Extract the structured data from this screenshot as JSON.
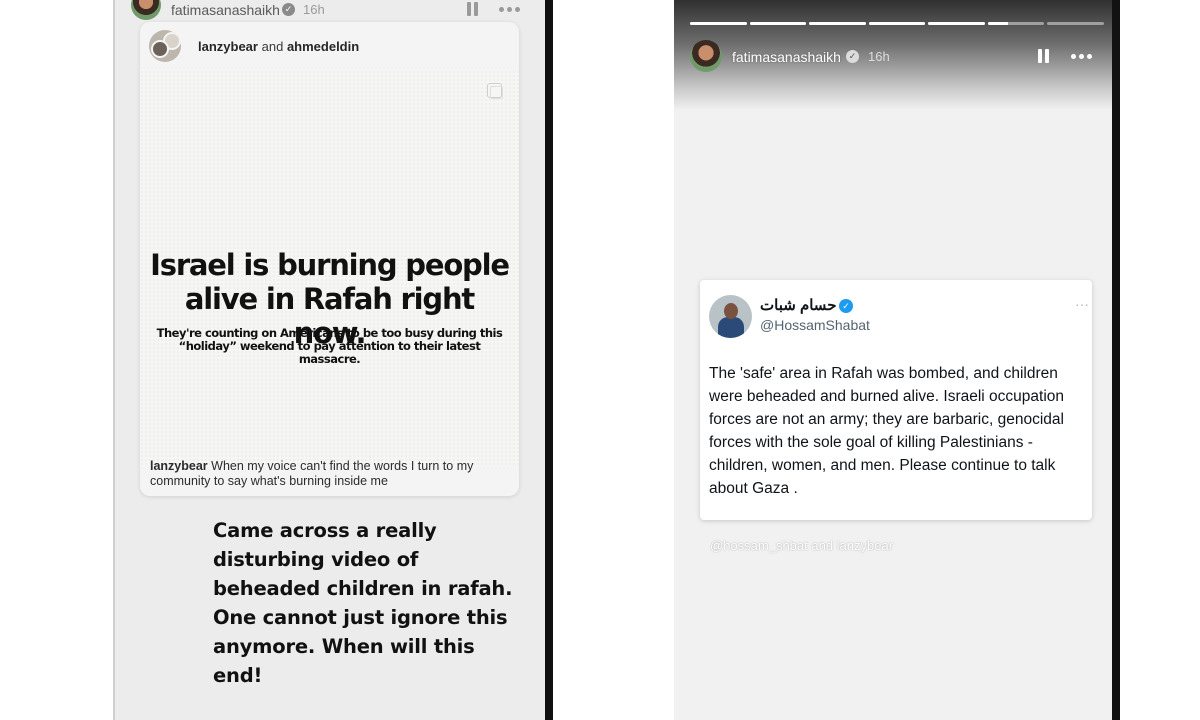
{
  "left_story": {
    "header": {
      "username": "fatimasanashaikh",
      "time": "16h",
      "icons": [
        "verified-badge-icon",
        "pause-icon",
        "more-options-icon"
      ]
    },
    "shared_post": {
      "collab_user_1": "lanzybear",
      "collab_joiner": "and",
      "collab_user_2": "ahmedeldin",
      "headline": "Israel is burning people alive in Rafah right now.",
      "subline": "They're counting on Americans to be too busy during this “holiday” weekend to pay attention to their latest massacre.",
      "caption_user": "lanzybear",
      "caption_text": "When my voice can't find the words I turn to my community to say what's burning inside me",
      "icons": [
        "multiple-posts-icon"
      ]
    },
    "story_text": "Came across a really disturbing video of beheaded children in rafah. One cannot just ignore this anymore. When will this end!"
  },
  "right_story": {
    "progress": {
      "segments": 7,
      "completed": 5,
      "current_fill": 0.35
    },
    "header": {
      "username": "fatimasanashaikh",
      "time": "16h",
      "icons": [
        "verified-badge-icon",
        "pause-icon",
        "more-options-icon"
      ]
    },
    "tweet": {
      "display_name": "حسام شبات",
      "handle": "@HossamShabat",
      "more": "···",
      "text": "The 'safe' area in Rafah was bombed, and children were beheaded and burned alive. Israeli occupation forces are not an army; they are barbaric, genocidal forces with the sole goal of killing Palestinians - children, women, and men. Please continue to talk about Gaza .",
      "icons": [
        "blue-verified-check-icon"
      ]
    },
    "mention_tags": "@hossam_shbat and lanzybear"
  },
  "colors": {
    "story_bg": "#ececec",
    "divider_dark": "#111111",
    "twitter_blue": "#1d9bf0",
    "tweet_text": "#0f1419",
    "handle_grey": "#536471"
  }
}
